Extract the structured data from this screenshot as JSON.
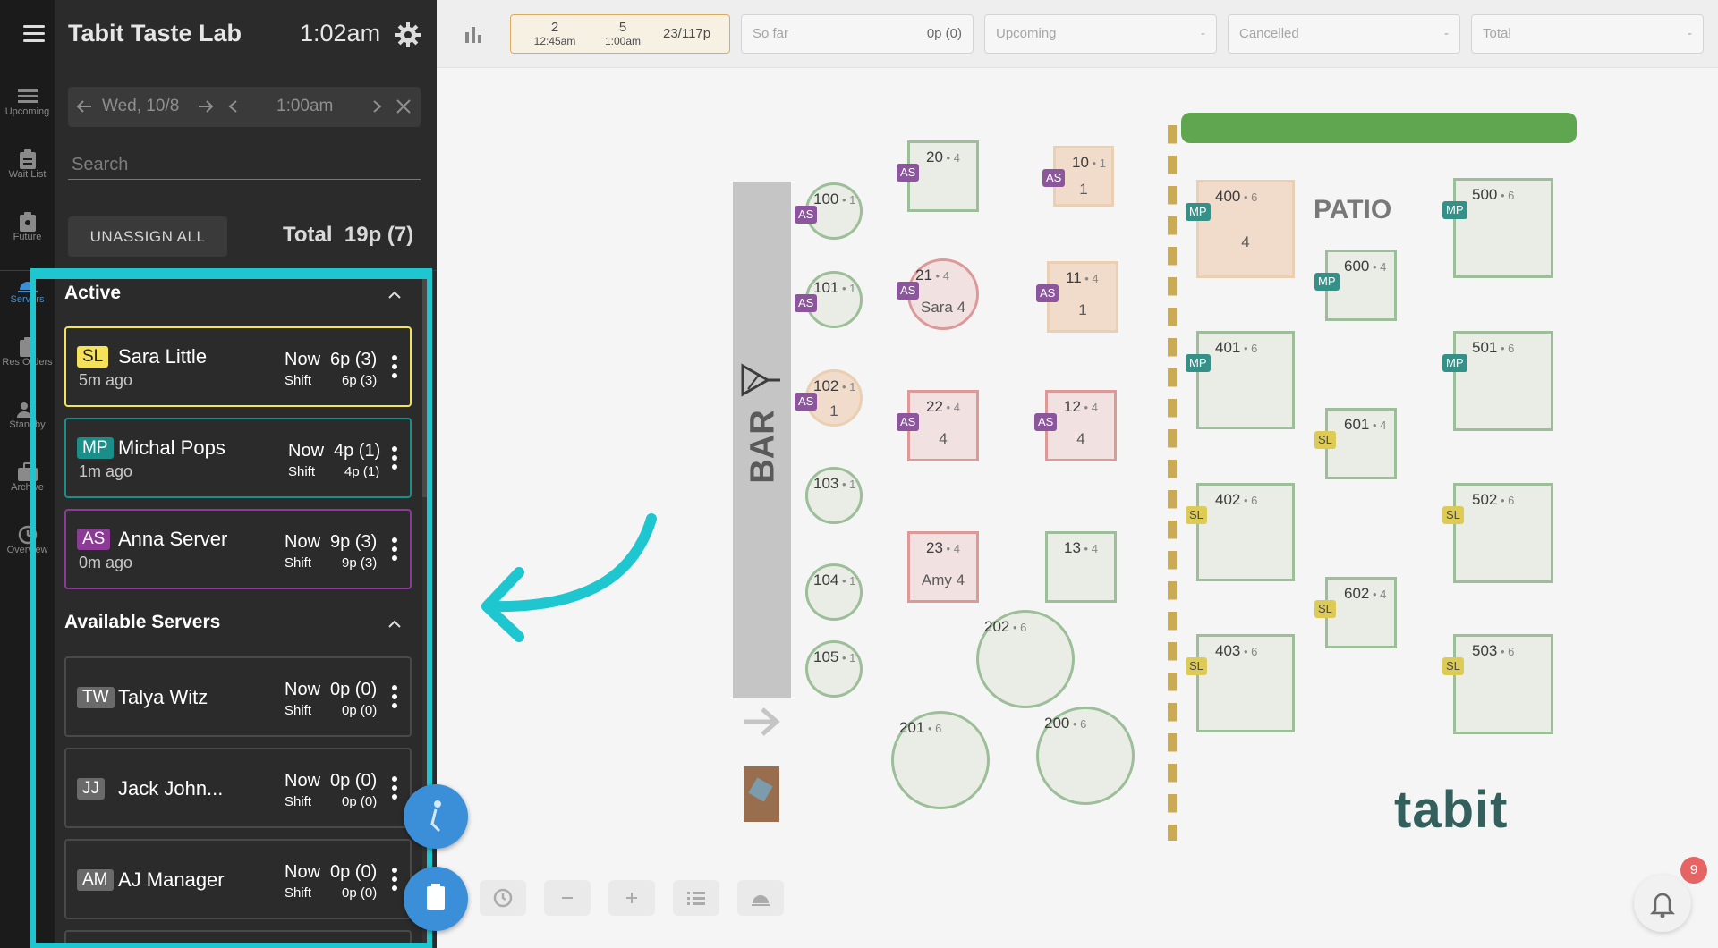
{
  "header": {
    "app_title": "Tabit Taste Lab",
    "time": "1:02am"
  },
  "rail": [
    {
      "label": "Upcoming",
      "icon": "list-icon"
    },
    {
      "label": "Wait List",
      "icon": "clipboard-icon"
    },
    {
      "label": "Future",
      "icon": "clipboard-user-icon"
    },
    {
      "label": "Servers",
      "icon": "waiter-icon"
    },
    {
      "label": "Res Orders",
      "icon": "clipboard-icon"
    },
    {
      "label": "Standby",
      "icon": "users-icon"
    },
    {
      "label": "Archive",
      "icon": "briefcase-icon"
    },
    {
      "label": "Overview",
      "icon": "clock-icon"
    }
  ],
  "date_nav": {
    "date": "Wed, 10/8",
    "time": "1:00am"
  },
  "search": {
    "placeholder": "Search"
  },
  "unassign_all": "UNASSIGN ALL",
  "total": {
    "label": "Total",
    "value": "19p (7)"
  },
  "sections": {
    "active": "Active",
    "available": "Available Servers"
  },
  "active_servers": [
    {
      "initials": "SL",
      "name": "Sara Little",
      "ago": "5m ago",
      "now_label": "Now",
      "now_value": "6p (3)",
      "shift_label": "Shift",
      "shift_value": "6p (3)"
    },
    {
      "initials": "MP",
      "name": "Michal Pops",
      "ago": "1m ago",
      "now_label": "Now",
      "now_value": "4p (1)",
      "shift_label": "Shift",
      "shift_value": "4p (1)"
    },
    {
      "initials": "AS",
      "name": "Anna Server",
      "ago": "0m ago",
      "now_label": "Now",
      "now_value": "9p (3)",
      "shift_label": "Shift",
      "shift_value": "9p (3)"
    }
  ],
  "available_servers": [
    {
      "initials": "TW",
      "name": "Talya Witz",
      "now_label": "Now",
      "now_value": "0p (0)",
      "shift_label": "Shift",
      "shift_value": "0p (0)"
    },
    {
      "initials": "JJ",
      "name": "Jack John...",
      "now_label": "Now",
      "now_value": "0p (0)",
      "shift_label": "Shift",
      "shift_value": "0p (0)"
    },
    {
      "initials": "AM",
      "name": "AJ Manager",
      "now_label": "Now",
      "now_value": "0p (0)",
      "shift_label": "Shift",
      "shift_value": "0p (0)"
    }
  ],
  "topbar": {
    "slot1_count": "2",
    "slot1_time": "12:45am",
    "slot2_count": "5",
    "slot2_time": "1:00am",
    "covers": "23/117p",
    "so_far_label": "So far",
    "so_far_value": "0p (0)",
    "upcoming_label": "Upcoming",
    "upcoming_value": "-",
    "cancelled_label": "Cancelled",
    "cancelled_value": "-",
    "total_label": "Total",
    "total_value": "-"
  },
  "floor": {
    "bar_label": "BAR",
    "patio_label": "PATIO",
    "logo": "tabit",
    "tables": [
      {
        "num": "20",
        "seats": "4",
        "server": "AS"
      },
      {
        "num": "10",
        "seats": "1",
        "server": "AS",
        "guests": "1"
      },
      {
        "num": "100",
        "seats": "1",
        "server": "AS"
      },
      {
        "num": "21",
        "seats": "4",
        "server": "AS",
        "guests": "Sara 4"
      },
      {
        "num": "11",
        "seats": "4",
        "server": "AS",
        "guests": "1"
      },
      {
        "num": "101",
        "seats": "1",
        "server": "AS"
      },
      {
        "num": "102",
        "seats": "1",
        "server": "AS",
        "guests": "1"
      },
      {
        "num": "22",
        "seats": "4",
        "server": "AS",
        "guests": "4"
      },
      {
        "num": "12",
        "seats": "4",
        "server": "AS",
        "guests": "4"
      },
      {
        "num": "103",
        "seats": "1"
      },
      {
        "num": "23",
        "seats": "4",
        "guests": "Amy 4"
      },
      {
        "num": "13",
        "seats": "4"
      },
      {
        "num": "104",
        "seats": "1"
      },
      {
        "num": "105",
        "seats": "1"
      },
      {
        "num": "202",
        "seats": "6"
      },
      {
        "num": "201",
        "seats": "6"
      },
      {
        "num": "200",
        "seats": "6"
      },
      {
        "num": "400",
        "seats": "6",
        "server": "MP",
        "guests": "4"
      },
      {
        "num": "600",
        "seats": "4",
        "server": "MP"
      },
      {
        "num": "500",
        "seats": "6",
        "server": "MP"
      },
      {
        "num": "401",
        "seats": "6",
        "server": "MP"
      },
      {
        "num": "501",
        "seats": "6",
        "server": "MP"
      },
      {
        "num": "601",
        "seats": "4",
        "server": "SL"
      },
      {
        "num": "402",
        "seats": "6",
        "server": "SL"
      },
      {
        "num": "502",
        "seats": "6",
        "server": "SL"
      },
      {
        "num": "602",
        "seats": "4",
        "server": "SL"
      },
      {
        "num": "403",
        "seats": "6",
        "server": "SL"
      },
      {
        "num": "503",
        "seats": "6",
        "server": "SL"
      }
    ]
  },
  "notifications": {
    "count": "9"
  },
  "colors": {
    "highlight": "#1ec6d0",
    "sl": "#f6e15a",
    "mp": "#1a8f8a",
    "as": "#8b3a96"
  }
}
